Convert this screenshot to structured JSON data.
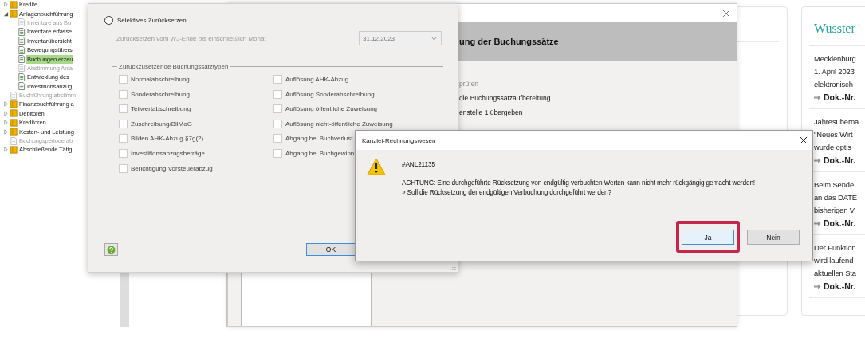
{
  "tree": [
    {
      "label": "Kredite",
      "kind": "folder",
      "expanded": false,
      "disabled": false,
      "selected": false
    },
    {
      "label": "Anlagenbuchführung",
      "kind": "folder",
      "expanded": true,
      "disabled": false,
      "selected": false,
      "children": [
        {
          "label": "Inventare aus Bu",
          "kind": "doc",
          "disabled": true,
          "selected": false
        },
        {
          "label": "Inventare erfasse",
          "kind": "doc",
          "disabled": false,
          "selected": false
        },
        {
          "label": "Inventarübersicht",
          "kind": "doc",
          "disabled": false,
          "selected": false
        },
        {
          "label": "Bewegungsübers",
          "kind": "doc",
          "disabled": false,
          "selected": false
        },
        {
          "label": "Buchungen erzeu",
          "kind": "doc",
          "disabled": false,
          "selected": true
        },
        {
          "label": "Abstimmung Anla",
          "kind": "doc",
          "disabled": true,
          "selected": false
        },
        {
          "label": "Entwicklung des",
          "kind": "doc",
          "disabled": false,
          "selected": false
        },
        {
          "label": "Investitionsabzug",
          "kind": "doc",
          "disabled": false,
          "selected": false
        }
      ]
    },
    {
      "label": "Buchführung abstimm",
      "kind": "doc",
      "disabled": true,
      "selected": false
    },
    {
      "label": "Finanzbuchführung a",
      "kind": "folder",
      "expanded": false,
      "disabled": false,
      "selected": false
    },
    {
      "label": "Debitoren",
      "kind": "folder",
      "expanded": false,
      "disabled": false,
      "selected": false
    },
    {
      "label": "Kreditoren",
      "kind": "folder",
      "expanded": false,
      "disabled": false,
      "selected": false
    },
    {
      "label": "Kosten- und Leistung",
      "kind": "folder",
      "expanded": false,
      "disabled": false,
      "selected": false
    },
    {
      "label": "Buchungsperiode ab",
      "kind": "doc",
      "disabled": true,
      "selected": false
    },
    {
      "label": "Abschließende Tätig",
      "kind": "folder",
      "expanded": false,
      "disabled": false,
      "selected": false
    }
  ],
  "background_dialog": {
    "heading": "ung der Buchungssätze",
    "steps": [
      {
        "text": "prüfen",
        "disabled": true
      },
      {
        "text": "die Buchungssatzaufbereitung",
        "disabled": false
      },
      {
        "text": "enstelle 1 übergeben",
        "disabled": false
      }
    ]
  },
  "reset_dialog": {
    "option": {
      "label": "Selektives Zurücksetzen",
      "selected": false
    },
    "month_label": "Zurücksetzen vom WJ-Ende bis einschließlich Monat",
    "month_value": "31.12.2023",
    "group_title": "Zurückzusetzende Buchungssatztypen",
    "columns": [
      [
        {
          "label": "Normalabschreibung",
          "checked": false
        },
        {
          "label": "Sonderabschreibung",
          "checked": false
        },
        {
          "label": "Teilwertabschreibung",
          "checked": false
        },
        {
          "label": "Zuschreibung/BilMoG",
          "checked": false
        },
        {
          "label": "Bilden AHK-Abzug §7g(2)",
          "checked": false
        },
        {
          "label": "Investitionsabzugsbeträge",
          "checked": false
        },
        {
          "label": "Berichtigung Vorsteuerabzug",
          "checked": false
        }
      ],
      [
        {
          "label": "Auflösung AHK-Abzug",
          "checked": false
        },
        {
          "label": "Auflösung Sonderabschreibung",
          "checked": false
        },
        {
          "label": "Auflösung öffentliche Zuweisung",
          "checked": false
        },
        {
          "label": "Auflösung nicht-öffentliche Zuweisung",
          "checked": false
        },
        {
          "label": "Abgang bei Buchverlust",
          "checked": false
        },
        {
          "label": "Abgang bei Buchgewinn",
          "checked": false
        }
      ]
    ],
    "ok_button": "OK"
  },
  "message_box": {
    "title": "Kanzlei-Rechnungswesen",
    "code": "#ANL21135",
    "lines": [
      "ACHTUNG: Eine durchgeführte Rücksetzung von endgültig verbuchten Werten kann nicht mehr rückgängig gemacht werden!",
      "» Soll die Rücksetzung der endgültigen Verbuchung durchgeführt werden?"
    ],
    "buttons": [
      {
        "label": "Ja",
        "default": true,
        "highlighted": true
      },
      {
        "label": "Nein",
        "default": false,
        "highlighted": false
      }
    ]
  },
  "tips_panel": {
    "title": "Wusster",
    "items": [
      {
        "lines": [
          "Mecklenburg",
          "1. April 2023",
          "elektronisch"
        ],
        "link": "Dok.-Nr."
      },
      {
        "lines": [
          "Jahresüberna",
          "\"Neues Wirt",
          "wurde optis"
        ],
        "link": "Dok.-Nr."
      },
      {
        "lines": [
          "Beim Sende",
          "an das DATE",
          "bisherigen V"
        ],
        "link": "Dok.-Nr."
      },
      {
        "lines": [
          "Der Funktion",
          "wird laufend",
          "aktuellen Sta"
        ],
        "link": "Dok.-Nr."
      }
    ]
  }
}
